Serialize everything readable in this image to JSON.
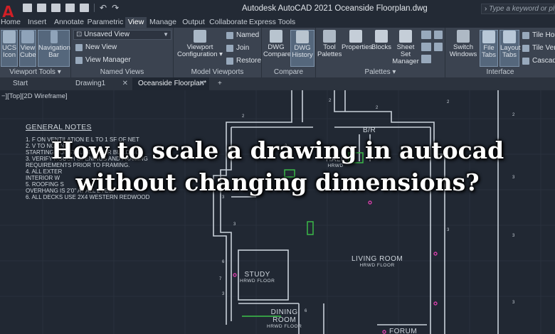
{
  "window": {
    "title": "Autodesk AutoCAD 2021   Oceanside Floorplan.dwg",
    "search_placeholder": "Type a keyword or phrase",
    "logo_letter": "A"
  },
  "ribbon_tabs": [
    "Home",
    "Insert",
    "Annotate",
    "Parametric",
    "View",
    "Manage",
    "Output",
    "Collaborate",
    "Express Tools"
  ],
  "active_ribbon_tab": "View",
  "ribbon": {
    "viewport_tools": {
      "title": "Viewport Tools",
      "ucs_icon": [
        "UCS",
        "Icon"
      ],
      "view_cube": [
        "View",
        "Cube"
      ],
      "navigation_bar": [
        "Navigation",
        "Bar"
      ]
    },
    "named_views": {
      "title": "Named Views",
      "dropdown_value": "Unsaved View",
      "new_view": "New View",
      "view_manager": "View Manager"
    },
    "model_viewports": {
      "title": "Model Viewports",
      "viewport_configuration": [
        "Viewport",
        "Configuration"
      ],
      "named": "Named",
      "join": "Join",
      "restore": "Restore"
    },
    "compare": {
      "title": "Compare",
      "dwg_compare": [
        "DWG",
        "Compare"
      ],
      "dwg_history": [
        "DWG",
        "History"
      ]
    },
    "palettes": {
      "title": "Palettes",
      "tool_palettes": [
        "Tool",
        "Palettes"
      ],
      "properties": "Properties",
      "blocks": "Blocks",
      "sheet_set_manager": [
        "Sheet Set",
        "Manager"
      ]
    },
    "interface": {
      "title": "Interface",
      "switch_windows": [
        "Switch",
        "Windows"
      ],
      "file_tabs": [
        "File",
        "Tabs"
      ],
      "layout_tabs": [
        "Layout",
        "Tabs"
      ],
      "tile_horizontally": "Tile Hori",
      "tile_vertically": "Tile Verti",
      "cascade": "Cascade"
    }
  },
  "doc_tabs": [
    {
      "label": "Start",
      "closable": false,
      "active": false
    },
    {
      "label": "Drawing1",
      "closable": true,
      "active": false
    },
    {
      "label": "Oceanside Floorplan*",
      "closable": true,
      "active": true
    }
  ],
  "doc_tab_close_glyph": "✕",
  "doc_tab_add_glyph": "+",
  "canvas": {
    "viewport_label": "−][Top][2D Wireframe]",
    "general_notes_title": "GENERAL NOTES",
    "notes_lines": [
      "1.   F    ON VENTILATION E    L TO 1 SF OF NET",
      "2.   V         TO      NG AND",
      "      STARTING CONSTRUCTION OR BUILDING.",
      "3.   VERIFY ROUGH OPENINGS AND FRAMING",
      "      REQUIREMENTS PRIOR TO FRAMING.",
      "4.   ALL EXTER",
      "      INTERIOR W",
      "5.   ROOFING S",
      "      OVERHANG IS 2'0\" AT ALL EVES.",
      "6.   ALL DECKS USE 2X4 WESTERN REDWOOD"
    ],
    "rooms": [
      {
        "id": "br",
        "name": "B/R",
        "sub": ""
      },
      {
        "id": "hall",
        "name": "HALL",
        "sub": "HRWD"
      },
      {
        "id": "living",
        "name": "LIVING ROOM",
        "sub": "HRWD FLOOR"
      },
      {
        "id": "study",
        "name": "STUDY",
        "sub": "HRWD FLOOR"
      },
      {
        "id": "dining",
        "name": "DINING",
        "sub": "ROOM"
      },
      {
        "id": "dining-sub",
        "name": "",
        "sub": "HRWD FLOOR"
      },
      {
        "id": "forum",
        "name": "FORUM",
        "sub": ""
      }
    ],
    "dimension_tags": [
      "2",
      "2",
      "2",
      "2",
      "2",
      "3",
      "3",
      "3",
      "3",
      "6",
      "7",
      "3",
      "6",
      "3",
      "3",
      "2"
    ]
  },
  "headline": {
    "line1": "How to scale a drawing in autocad",
    "line2": "without changing dimensions?"
  },
  "colors": {
    "canvas_bg": "#212833",
    "ribbon_bg": "#3b4350",
    "wall_line": "#c9d1da",
    "grid_line": "#2a3340",
    "accent_green": "#3cc24a",
    "accent_magenta": "#d43fa8",
    "logo_red": "#d11f26"
  },
  "icons": [
    "quick-access-new-icon",
    "quick-access-open-icon",
    "quick-access-save-icon",
    "quick-access-saveas-icon",
    "quick-access-print-icon",
    "undo-icon",
    "redo-icon",
    "search-icon"
  ]
}
